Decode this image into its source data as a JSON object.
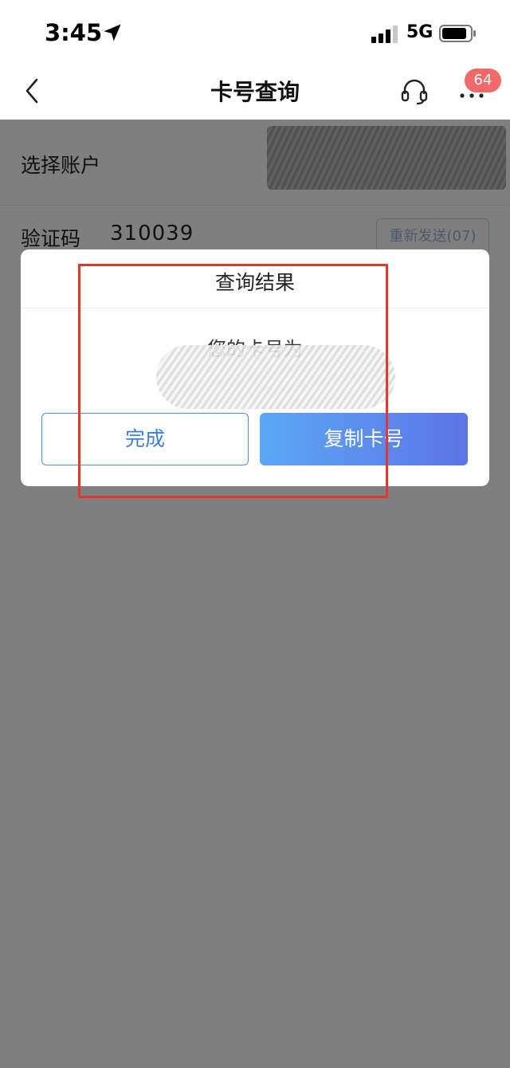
{
  "status_bar": {
    "time": "3:45",
    "network": "5G"
  },
  "nav": {
    "title": "卡号查询",
    "badge_count": "64"
  },
  "page": {
    "account_label": "选择账户",
    "verify_label": "验证码",
    "verify_code": "310039",
    "resend_label": "重新发送(07)"
  },
  "dialog": {
    "title": "查询结果",
    "message": "您的卡号为",
    "done_label": "完成",
    "copy_label": "复制卡号"
  },
  "colors": {
    "accent_blue": "#4f8fe0",
    "badge_red": "#f06a6a",
    "annotation_red": "#e4372e"
  },
  "icons": [
    "location-arrow-icon",
    "signal-icon",
    "battery-icon",
    "back-chevron-icon",
    "headset-icon",
    "more-icon"
  ]
}
